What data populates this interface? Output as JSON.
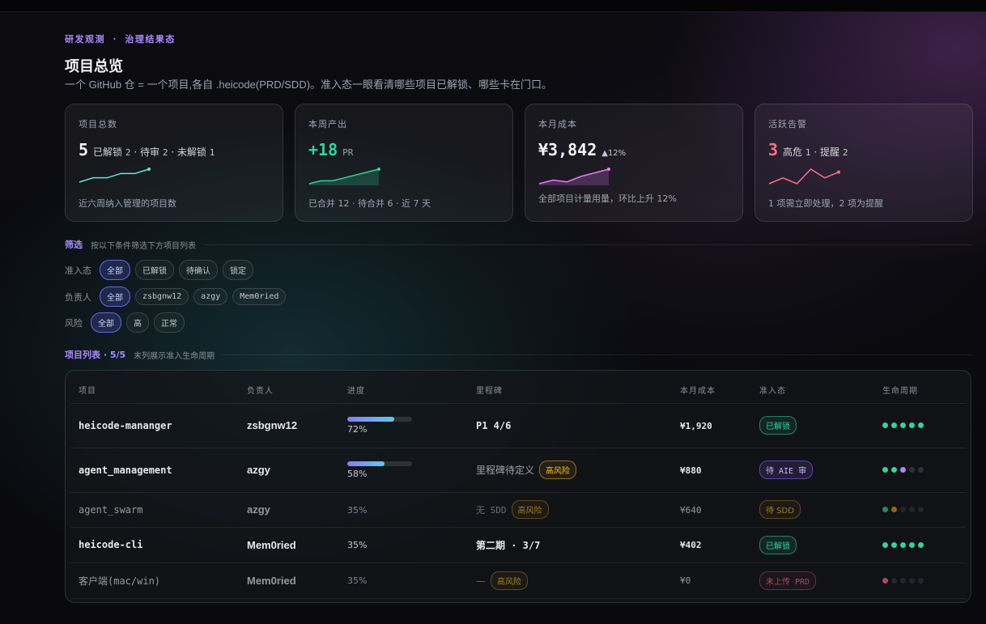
{
  "header": {
    "eyebrow": "研发观测 · 治理结果态",
    "title": "项目总览",
    "subtitle": "一个 GitHub 仓 = 一个项目,各自 .heicode(PRD/SDD)。准入态一眼看清哪些项目已解锁、哪些卡在门口。"
  },
  "cards": {
    "projects": {
      "label": "项目总数",
      "value": "5",
      "k1": "已解锁",
      "v1": "2",
      "k2": "待审",
      "v2": "2",
      "k3": "未解锁",
      "v3": "1",
      "foot": "近六周纳入管理的项目数",
      "spark": [
        3,
        4,
        4,
        5,
        5,
        6
      ],
      "color": "#5eead4"
    },
    "output": {
      "label": "本周产出",
      "value": "+18",
      "unit": "PR",
      "foot": "已合并 12 · 待合并 6 · 近 7 天",
      "spark": [
        2,
        3,
        3,
        4,
        5,
        6,
        7
      ],
      "color": "#34d399"
    },
    "cost": {
      "label": "本月成本",
      "value": "¥3,842",
      "trend": "▲12%",
      "foot": "全部项目计量用量，环比上升 12%",
      "spark": [
        2,
        3,
        2.5,
        4,
        5,
        6
      ],
      "color": "#e879f9"
    },
    "alerts": {
      "label": "活跃告警",
      "value": "3",
      "k1": "高危",
      "v1": "1",
      "k2": "提醒",
      "v2": "2",
      "foot": "1 项需立即处理，2 项为提醒",
      "spark": [
        2,
        4,
        2,
        7,
        4,
        6
      ],
      "color": "#fb7185"
    }
  },
  "filters": {
    "title": "筛选",
    "desc": "按以下条件筛选下方项目列表",
    "gate": {
      "label": "准入态",
      "options": [
        "全部",
        "已解锁",
        "待确认",
        "锁定"
      ]
    },
    "owner": {
      "label": "负责人",
      "options": [
        "全部",
        "zsbgnw12",
        "azgy",
        "Mem0ried"
      ]
    },
    "risk": {
      "label": "风险",
      "options": [
        "全部",
        "高",
        "正常"
      ]
    }
  },
  "list": {
    "title": "项目列表 · 5/5",
    "desc": "末列展示准入生命周期",
    "columns": [
      "项目",
      "负责人",
      "进度",
      "里程碑",
      "本月成本",
      "准入态",
      "生命周期"
    ],
    "rows": [
      {
        "name": "heicode-mananger",
        "owner": "zsbgnw12",
        "progress": 72,
        "progress_label": "72%",
        "milestone": "P1 4/6",
        "cost": "¥1,920",
        "gate": "已解锁",
        "lifecycle": [
          "g",
          "g",
          "g",
          "g",
          "g"
        ]
      },
      {
        "name": "agent_management",
        "owner": "azgy",
        "progress": 58,
        "progress_label": "58%",
        "milestone": "里程碑待定义",
        "risk": "高风险",
        "cost": "¥880",
        "gate": "待 AIE 审",
        "lifecycle": [
          "g",
          "g",
          "p",
          "n",
          "n"
        ]
      },
      {
        "name": "agent_swarm",
        "owner": "azgy",
        "progress_label": "35%",
        "milestone": "无 SDD",
        "risk": "高风险",
        "cost": "¥640",
        "gate": "待 SDD",
        "lifecycle": [
          "g",
          "a",
          "n",
          "n",
          "n"
        ]
      },
      {
        "name": "heicode-cli",
        "owner": "Mem0ried",
        "progress_label": "35%",
        "milestone": "第二期 · 3/7",
        "cost": "¥402",
        "gate": "已解锁",
        "lifecycle": [
          "g",
          "g",
          "g",
          "g",
          "g"
        ]
      },
      {
        "name": "客户端(mac/win)",
        "owner": "Mem0ried",
        "progress_label": "35%",
        "milestone": "—",
        "risk": "高风险",
        "cost": "¥0",
        "gate": "未上传 PRD",
        "lifecycle": [
          "r",
          "n",
          "n",
          "n",
          "n"
        ]
      }
    ]
  }
}
